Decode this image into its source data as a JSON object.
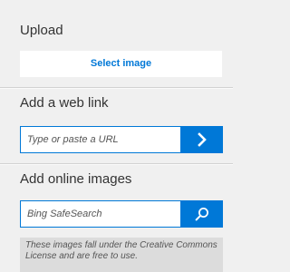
{
  "upload": {
    "title": "Upload",
    "select_image_label": "Select image"
  },
  "web_link": {
    "title": "Add a web link",
    "input_placeholder": "Type or paste a URL",
    "go_icon": "chevron-right-icon"
  },
  "online_images": {
    "title": "Add online images",
    "search_placeholder": "Bing SafeSearch",
    "search_icon": "search-icon",
    "license_notice": "These images fall under the Creative Commons License and are free to use."
  },
  "colors": {
    "accent": "#0078d7",
    "background": "#f0f0f0",
    "notice_background": "#dcdcdc",
    "text": "#333333"
  }
}
